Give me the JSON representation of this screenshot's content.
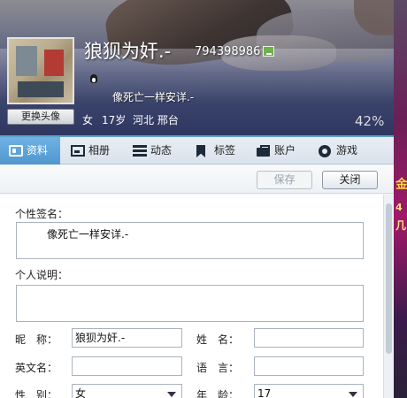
{
  "profile": {
    "nickname": "狼狈为奸.-",
    "qq_number": "794398986",
    "signature": "像死亡一样安详.-",
    "gender": "女",
    "age": "17岁",
    "location": "河北 邢台",
    "completion": "42%",
    "change_avatar_label": "更换头像"
  },
  "tabs": [
    {
      "label": "资料",
      "icon": "id-card-icon",
      "active": true
    },
    {
      "label": "相册",
      "icon": "photo-icon",
      "active": false
    },
    {
      "label": "动态",
      "icon": "list-icon",
      "active": false
    },
    {
      "label": "标签",
      "icon": "bookmark-icon",
      "active": false
    },
    {
      "label": "账户",
      "icon": "briefcase-icon",
      "active": false
    },
    {
      "label": "游戏",
      "icon": "game-icon",
      "active": false
    }
  ],
  "toolbar": {
    "save_label": "保存",
    "close_label": "关闭"
  },
  "form": {
    "signature_label": "个性签名：",
    "signature_value": "像死亡一样安详.-",
    "description_label": "个人说明：",
    "description_value": "",
    "nickname_label": "昵　称：",
    "nickname_value": "狼狈为奸.-",
    "surname_label": "姓　名：",
    "surname_value": "",
    "english_name_label": "英文名：",
    "english_name_value": "",
    "language_label": "语　言：",
    "language_value": "",
    "gender_label": "性　别：",
    "gender_value": "女",
    "age_label": "年　龄：",
    "age_value": "17"
  },
  "side_banner": {
    "text1": "金",
    "text2": "4",
    "text3": "几"
  },
  "colors": {
    "active_tab": "#4f97cf",
    "header_bg": "#39426a"
  }
}
